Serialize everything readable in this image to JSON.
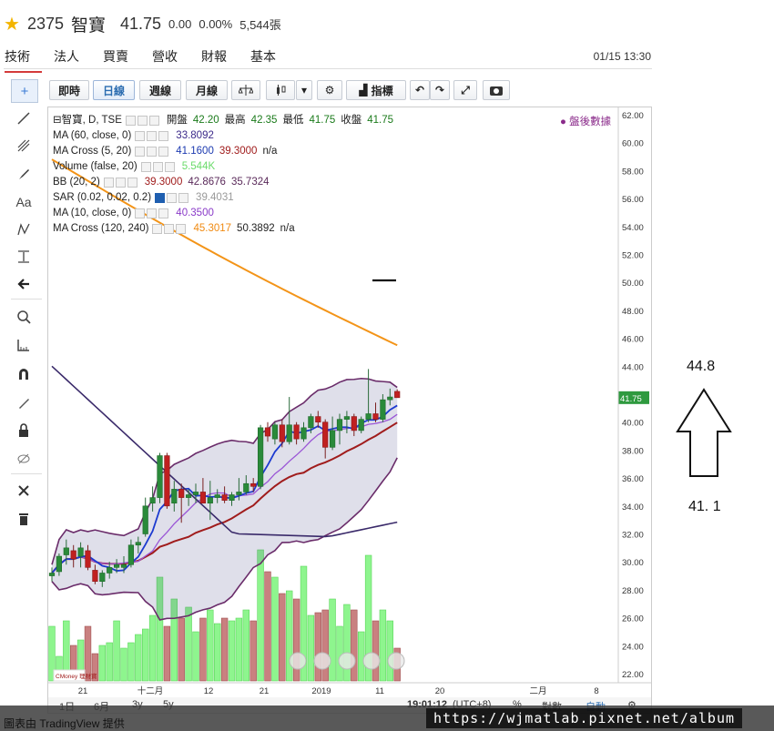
{
  "header": {
    "code": "2375",
    "name": "智寶",
    "price": "41.75",
    "change": "0.00",
    "change_pct": "0.00%",
    "volume": "5,544張"
  },
  "tabs": [
    "技術",
    "法人",
    "買賣",
    "營收",
    "財報",
    "基本"
  ],
  "datetime": "01/15 13:30",
  "toolbar": {
    "intraday": "即時",
    "daily": "日線",
    "weekly": "週線",
    "monthly": "月線",
    "indicators": "指標"
  },
  "legend": [
    {
      "label": "智寶, D, TSE",
      "values": [
        {
          "t": "開盤",
          "c": "#222"
        },
        {
          "t": "42.20",
          "c": "#1a7a1a"
        },
        {
          "t": "最高",
          "c": "#222"
        },
        {
          "t": "42.35",
          "c": "#1a7a1a"
        },
        {
          "t": "最低",
          "c": "#222"
        },
        {
          "t": "41.75",
          "c": "#1a7a1a"
        },
        {
          "t": "收盤",
          "c": "#222"
        },
        {
          "t": "41.75",
          "c": "#1a7a1a"
        }
      ]
    },
    {
      "label": "MA (60, close, 0)",
      "values": [
        {
          "t": "33.8092",
          "c": "#3c2a8a"
        }
      ]
    },
    {
      "label": "MA Cross (5, 20)",
      "values": [
        {
          "t": "41.1600",
          "c": "#1c3ab0"
        },
        {
          "t": "39.3000",
          "c": "#a01c1c"
        },
        {
          "t": "n/a",
          "c": "#222"
        }
      ]
    },
    {
      "label": "Volume (false, 20)",
      "values": [
        {
          "t": "5.544K",
          "c": "#6adb6a"
        }
      ]
    },
    {
      "label": "BB (20, 2)",
      "values": [
        {
          "t": "39.3000",
          "c": "#a01c1c"
        },
        {
          "t": "42.8676",
          "c": "#5a2a5a"
        },
        {
          "t": "35.7324",
          "c": "#5a2a5a"
        }
      ]
    },
    {
      "label": "SAR (0.02, 0.02, 0.2)",
      "values": [
        {
          "t": "39.4031",
          "c": "#999"
        }
      ]
    },
    {
      "label": "MA (10, close, 0)",
      "values": [
        {
          "t": "40.3500",
          "c": "#8a3ac8"
        }
      ]
    },
    {
      "label": "MA Cross (120, 240)",
      "values": [
        {
          "t": "45.3017",
          "c": "#f08a12"
        },
        {
          "t": "50.3892",
          "c": "#222"
        },
        {
          "t": "n/a",
          "c": "#222"
        }
      ]
    }
  ],
  "post_market": "盤後數據",
  "yaxis": [
    "62.00",
    "60.00",
    "58.00",
    "56.00",
    "54.00",
    "52.00",
    "50.00",
    "48.00",
    "46.00",
    "44.00",
    "42.00",
    "41.75",
    "40.00",
    "38.00",
    "36.00",
    "34.00",
    "32.00",
    "30.00",
    "28.00",
    "26.00",
    "24.00",
    "22.00"
  ],
  "xaxis": [
    "21",
    "十二月",
    "12",
    "21",
    "2019",
    "11",
    "20",
    "二月",
    "8"
  ],
  "footer": {
    "range1": "1日",
    "range2": "6月",
    "range3": "3y",
    "range4": "5y",
    "clock": "19:01:12",
    "tz": "(UTC+8)",
    "pct": "%",
    "log": "對數",
    "auto": "自動"
  },
  "brand": "CMoney 理財寶",
  "annotation": {
    "top": "44.8",
    "bottom": "41. 1"
  },
  "watermark": "https://wjmatlab.pixnet.net/album",
  "bottom_text": "圖表由 TradingView 提供",
  "chart_data": {
    "type": "candlestick",
    "ylim": [
      22,
      62
    ],
    "candles": [
      {
        "o": 29.0,
        "h": 29.6,
        "l": 28.6,
        "c": 29.2
      },
      {
        "o": 29.3,
        "h": 30.6,
        "l": 29.0,
        "c": 30.4
      },
      {
        "o": 30.5,
        "h": 31.6,
        "l": 29.8,
        "c": 31.0
      },
      {
        "o": 30.8,
        "h": 31.2,
        "l": 29.6,
        "c": 30.2
      },
      {
        "o": 30.4,
        "h": 31.4,
        "l": 29.6,
        "c": 31.0
      },
      {
        "o": 30.8,
        "h": 31.2,
        "l": 29.4,
        "c": 29.6
      },
      {
        "o": 29.4,
        "h": 29.8,
        "l": 28.4,
        "c": 28.6
      },
      {
        "o": 28.6,
        "h": 29.4,
        "l": 28.2,
        "c": 29.2
      },
      {
        "o": 29.2,
        "h": 30.0,
        "l": 28.8,
        "c": 29.6
      },
      {
        "o": 29.6,
        "h": 30.2,
        "l": 29.2,
        "c": 29.8
      },
      {
        "o": 29.6,
        "h": 30.4,
        "l": 29.2,
        "c": 29.8
      },
      {
        "o": 29.8,
        "h": 31.6,
        "l": 29.6,
        "c": 31.2
      },
      {
        "o": 31.2,
        "h": 31.8,
        "l": 30.6,
        "c": 31.4
      },
      {
        "o": 32.0,
        "h": 34.6,
        "l": 31.8,
        "c": 34.0
      },
      {
        "o": 34.2,
        "h": 35.4,
        "l": 33.6,
        "c": 34.6
      },
      {
        "o": 34.6,
        "h": 37.8,
        "l": 34.2,
        "c": 37.6
      },
      {
        "o": 37.6,
        "h": 37.8,
        "l": 33.8,
        "c": 34.0
      },
      {
        "o": 34.2,
        "h": 35.8,
        "l": 33.6,
        "c": 35.2
      },
      {
        "o": 35.2,
        "h": 35.6,
        "l": 32.8,
        "c": 34.6
      },
      {
        "o": 34.6,
        "h": 35.2,
        "l": 34.0,
        "c": 34.8
      },
      {
        "o": 34.8,
        "h": 35.6,
        "l": 34.2,
        "c": 35.0
      },
      {
        "o": 35.0,
        "h": 36.0,
        "l": 34.4,
        "c": 34.2
      },
      {
        "o": 34.2,
        "h": 35.8,
        "l": 33.0,
        "c": 34.6
      },
      {
        "o": 34.6,
        "h": 35.2,
        "l": 34.2,
        "c": 34.8
      },
      {
        "o": 34.8,
        "h": 35.4,
        "l": 34.2,
        "c": 34.4
      },
      {
        "o": 34.4,
        "h": 35.0,
        "l": 34.0,
        "c": 34.8
      },
      {
        "o": 34.8,
        "h": 36.0,
        "l": 34.4,
        "c": 35.0
      },
      {
        "o": 35.0,
        "h": 36.2,
        "l": 34.8,
        "c": 35.6
      },
      {
        "o": 35.6,
        "h": 36.0,
        "l": 35.0,
        "c": 35.4
      },
      {
        "o": 35.4,
        "h": 39.8,
        "l": 35.2,
        "c": 39.6
      },
      {
        "o": 39.6,
        "h": 40.0,
        "l": 38.6,
        "c": 39.0
      },
      {
        "o": 38.8,
        "h": 40.0,
        "l": 38.4,
        "c": 39.8
      },
      {
        "o": 39.8,
        "h": 40.2,
        "l": 38.2,
        "c": 38.6
      },
      {
        "o": 38.6,
        "h": 41.8,
        "l": 38.4,
        "c": 39.8
      },
      {
        "o": 39.8,
        "h": 40.0,
        "l": 38.4,
        "c": 38.8
      },
      {
        "o": 38.8,
        "h": 40.0,
        "l": 38.6,
        "c": 39.6
      },
      {
        "o": 39.6,
        "h": 40.6,
        "l": 39.2,
        "c": 40.4
      },
      {
        "o": 40.4,
        "h": 40.8,
        "l": 39.6,
        "c": 40.0
      },
      {
        "o": 40.0,
        "h": 40.2,
        "l": 37.4,
        "c": 38.2
      },
      {
        "o": 38.2,
        "h": 40.4,
        "l": 38.0,
        "c": 39.4
      },
      {
        "o": 39.4,
        "h": 40.6,
        "l": 38.4,
        "c": 40.2
      },
      {
        "o": 40.2,
        "h": 40.8,
        "l": 39.2,
        "c": 40.4
      },
      {
        "o": 40.4,
        "h": 40.6,
        "l": 39.0,
        "c": 39.4
      },
      {
        "o": 39.4,
        "h": 40.4,
        "l": 39.2,
        "c": 40.2
      },
      {
        "o": 40.2,
        "h": 43.8,
        "l": 40.0,
        "c": 40.6
      },
      {
        "o": 40.6,
        "h": 41.4,
        "l": 40.0,
        "c": 40.2
      },
      {
        "o": 40.2,
        "h": 42.0,
        "l": 40.0,
        "c": 41.6
      },
      {
        "o": 41.6,
        "h": 42.4,
        "l": 41.2,
        "c": 41.8
      },
      {
        "o": 42.2,
        "h": 42.35,
        "l": 41.75,
        "c": 41.75
      }
    ],
    "volumes": [
      20,
      9,
      22,
      13,
      15,
      20,
      10,
      13,
      14,
      22,
      12,
      14,
      17,
      19,
      24,
      38,
      20,
      30,
      23,
      27,
      18,
      23,
      26,
      21,
      23,
      22,
      23,
      26,
      22,
      48,
      40,
      38,
      32,
      33,
      30,
      42,
      24,
      25,
      26,
      30,
      20,
      28,
      26,
      18,
      46,
      22,
      26,
      22,
      12
    ]
  }
}
